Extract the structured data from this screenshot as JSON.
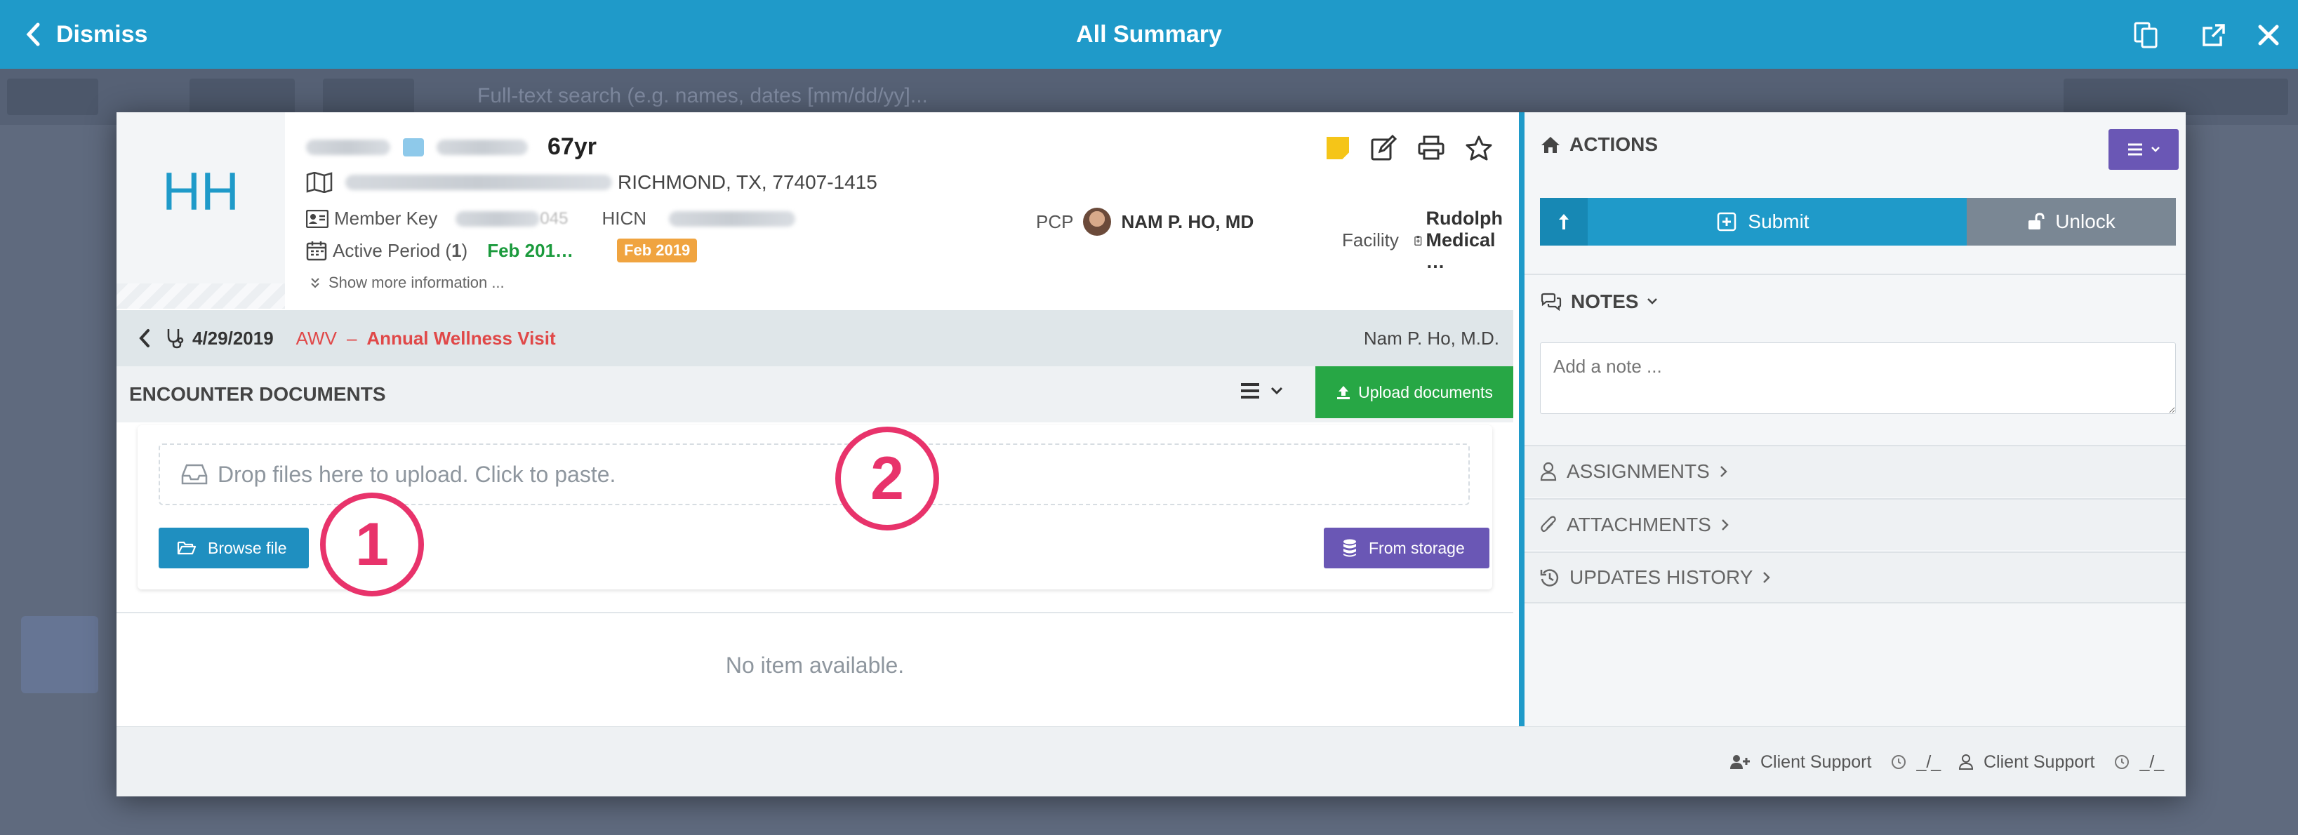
{
  "topbar": {
    "dismiss_label": "Dismiss",
    "title": "All Summary"
  },
  "bg": {
    "search_placeholder": "Full-text search (e.g. names, dates [mm/dd/yy]..."
  },
  "patient": {
    "initials": "HH",
    "age": "67yr",
    "address_city": "RICHMOND, TX, 77407-1415",
    "member_key_label": "Member Key",
    "member_key_suffix": "045",
    "hicn_label": "HICN",
    "active_period_label": "Active Period (",
    "active_period_count": "1",
    "active_period_close": ")",
    "active_period_value": "Feb 201…",
    "active_badge": "Feb 2019",
    "pcp_label": "PCP",
    "pcp_name": "NAM P. HO, MD",
    "facility_label": "Facility",
    "facility_name": "Rudolph Medical …",
    "show_more": "Show more information ..."
  },
  "encounter": {
    "date": "4/29/2019",
    "code": "AWV",
    "separator": "–",
    "type": "Annual Wellness Visit",
    "provider": "Nam P. Ho, M.D."
  },
  "documents": {
    "title": "ENCOUNTER DOCUMENTS",
    "upload_label": "Upload documents",
    "drop_text": "Drop files here to upload. Click to paste.",
    "browse_label": "Browse file",
    "storage_label": "From storage",
    "empty_text": "No item available.",
    "callout_1": "1",
    "callout_2": "2"
  },
  "actions": {
    "title": "ACTIONS",
    "submit_label": "Submit",
    "unlock_label": "Unlock"
  },
  "notes": {
    "title": "NOTES",
    "placeholder": "Add a note ..."
  },
  "accordions": {
    "assignments": "ASSIGNMENTS",
    "attachments": "ATTACHMENTS",
    "updates": "UPDATES HISTORY"
  },
  "footer": {
    "support1": "Client Support",
    "time1": "_/_",
    "support2": "Client Support",
    "time2": "_/_"
  },
  "colors": {
    "primary": "#1f9ac9",
    "success": "#27a745",
    "purple": "#6a57b5",
    "danger": "#e04848",
    "callout": "#e8336b",
    "badge": "#f0a440"
  }
}
